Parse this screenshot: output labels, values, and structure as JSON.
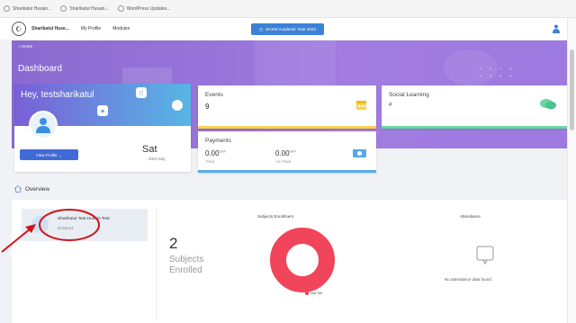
{
  "browser_tabs": [
    "Sharikatul Husain...",
    "Sharikatul Husain...",
    "WordPress Updates..."
  ],
  "nav": {
    "site_name": "Sharikatul Huse...",
    "links": [
      "My Profile",
      "Modules"
    ],
    "academic_year_button": "SHSW Academic Year 2023"
  },
  "breadcrumb": "Home",
  "page_title": "Dashboard",
  "profile": {
    "greeting": "Hey, testsharikatul",
    "view_profile_label": "View Profile →",
    "day": "Sat",
    "date": "23rd July"
  },
  "events": {
    "title": "Events",
    "value": "9"
  },
  "social": {
    "title": "Social Learning",
    "value": "#"
  },
  "payments": {
    "title": "Payments",
    "paid_amount": "0.00",
    "paid_currency": "GBP",
    "paid_label": "Paid",
    "unpaid_amount": "0.00",
    "unpaid_currency": "GBP",
    "unpaid_label": "Un Paid"
  },
  "overview": {
    "title": "Overview",
    "student_name": "Sharikatul Test Husain Test",
    "student_id": "shsw041",
    "subjects_section_title": "Subjects Enrollment",
    "subjects_count": "2",
    "subjects_label": "Subjects Enrolled",
    "legend_label": "Not Set",
    "attendance_title": "Attendance",
    "attendance_empty": "No attendance data found."
  },
  "colors": {
    "hero": "#9b7ce0",
    "primary": "#3f6ad8",
    "events_accent": "#fbd24b",
    "social_accent": "#67d8a2",
    "payments_accent": "#56a9e6",
    "donut": "#f0455a",
    "annotation": "#d0141b"
  },
  "icons": [
    "calendar-icon",
    "chat-icon",
    "money-icon",
    "user-icon",
    "home-icon",
    "attendance-icon"
  ]
}
